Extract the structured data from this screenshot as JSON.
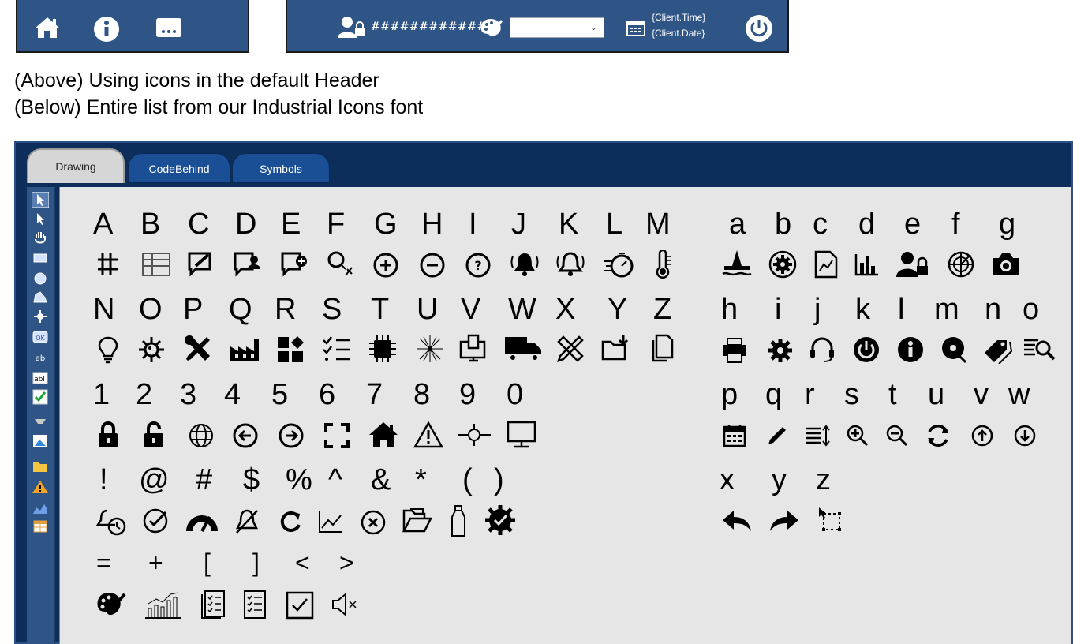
{
  "header_left": {
    "icons": [
      "home-icon",
      "info-icon",
      "more-icon"
    ]
  },
  "header_right": {
    "user_text": "############",
    "client_time": "{Client.Time}",
    "client_date": "{Client.Date}",
    "icons": [
      "user-lock-icon",
      "palette-icon",
      "calendar-icon",
      "power-icon"
    ]
  },
  "captions": {
    "above": "(Above) Using icons in the default Header",
    "below": "(Below) Entire list from our Industrial Icons font"
  },
  "tabs": [
    "Drawing",
    "CodeBehind",
    "Symbols"
  ],
  "glyph_rows": [
    [
      "A",
      "B",
      "C",
      "D",
      "E",
      "F",
      "G",
      "H",
      "I",
      "J",
      "K",
      "L",
      "M"
    ],
    [
      "N",
      "O",
      "P",
      "Q",
      "R",
      "S",
      "T",
      "U",
      "V",
      "W",
      "X",
      "Y",
      "Z"
    ],
    [
      "1",
      "2",
      "3",
      "4",
      "5",
      "6",
      "7",
      "8",
      "9",
      "0"
    ],
    [
      "!",
      "@",
      "#",
      "$",
      "%",
      "^",
      "&",
      "*",
      "(",
      ")"
    ],
    [
      "=",
      "+",
      "[",
      "]",
      "<",
      ">"
    ]
  ],
  "glyph_rows_right": [
    [
      "a",
      "b",
      "c",
      "d",
      "e",
      "f",
      "g"
    ],
    [
      "h",
      "i",
      "j",
      "k",
      "l",
      "m",
      "n",
      "o"
    ],
    [
      "p",
      "q",
      "r",
      "s",
      "t",
      "u",
      "v",
      "w"
    ],
    [
      "x",
      "y",
      "z"
    ]
  ],
  "icons_left": [
    [
      "grid-icon",
      "table-icon",
      "edit-comment-icon",
      "user-comment-icon",
      "add-comment-icon",
      "search-link-icon",
      "plus-circle-icon",
      "minus-circle-icon",
      "question-circle-icon",
      "alarm-on-icon",
      "alarm-ring-icon",
      "timer-icon",
      "thermometer-icon"
    ],
    [
      "lightbulb-icon",
      "virus-icon",
      "tools-icon",
      "factory-icon",
      "dashboard-icon",
      "checklist-icon",
      "chip-icon",
      "network-icon",
      "computer-icon",
      "truck-icon",
      "ruler-pencil-icon",
      "folder-download-icon",
      "files-icon"
    ],
    [
      "lock-icon",
      "unlock-icon",
      "globe-icon",
      "arrow-left-circle-icon",
      "arrow-right-circle-icon",
      "fullscreen-icon",
      "home-icon",
      "warning-icon",
      "satellite-icon",
      "monitor-icon"
    ],
    [
      "alarm-clock-icon",
      "check-circle-icon",
      "gauge-icon",
      "bell-off-icon",
      "refresh-icon",
      "line-chart-icon",
      "close-circle-icon",
      "open-folder-icon",
      "bottle-icon",
      "gear-check-icon"
    ],
    [
      "palette-icon",
      "bar-line-chart-icon",
      "report-icon",
      "list-icon",
      "checkbox-icon",
      "mute-icon"
    ]
  ],
  "icons_right": [
    [
      "oil-rig-icon",
      "gear-circle-icon",
      "chart-doc-icon",
      "bar-chart-icon",
      "user-lock-icon",
      "radar-icon",
      "camera-icon"
    ],
    [
      "printer-icon",
      "gear-icon",
      "headset-icon",
      "power-icon",
      "info-icon",
      "disc-icon",
      "tags-icon",
      "search-list-icon"
    ],
    [
      "calendar-icon",
      "pencil-icon",
      "sort-icon",
      "zoom-in-icon",
      "zoom-out-icon",
      "sync-icon",
      "arrow-up-circle-icon",
      "arrow-down-circle-icon"
    ],
    [
      "undo-icon",
      "redo-icon",
      "select-area-icon"
    ]
  ],
  "colors": {
    "header_bg": "#2f5587",
    "editor_bg": "#0d2d5a",
    "canvas_bg": "#e6e6e6",
    "tab_active_bg": "#d6d6d6",
    "tab_inactive_bg": "#1a4f96"
  }
}
